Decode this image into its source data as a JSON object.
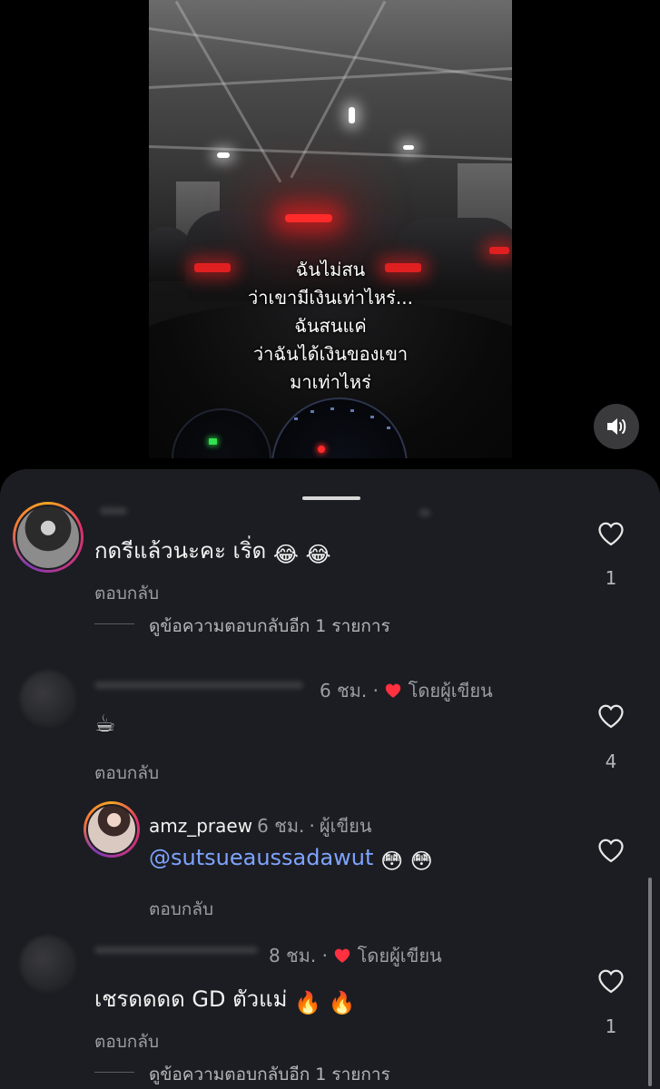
{
  "video": {
    "caption_lines": [
      "ฉันไม่สน",
      "ว่าเขามีเงินเท่าไหร่...",
      "ฉันสนแค่",
      "ว่าฉันได้เงินของเขา",
      "มาเท่าไหร่"
    ],
    "mute_icon": "speaker-icon"
  },
  "comments": {
    "c1": {
      "text": "กดรีแล้วนะคะ เริ่ด",
      "emojis": [
        "😂",
        "😂"
      ],
      "reply_label": "ตอบกลับ",
      "view_more": "ดูข้อความตอบกลับอีก 1 รายการ",
      "likes": "1"
    },
    "c2": {
      "time": "6 ชม.",
      "dot": "·",
      "liked_by_author": "โดยผู้เขียน",
      "text": "☕",
      "reply_label": "ตอบกลับ",
      "likes": "4"
    },
    "reply": {
      "username": "amz_praew",
      "time": "6 ชม.",
      "dot": "·",
      "author_badge": "ผู้เขียน",
      "mention": "@sutsueaussadawut",
      "emojis": [
        "😳",
        "😳"
      ],
      "reply_label": "ตอบกลับ"
    },
    "c3": {
      "time": "8 ชม.",
      "dot": "·",
      "liked_by_author": "โดยผู้เขียน",
      "text": "เชรดดดด GD ตัวแม่",
      "emojis": [
        "🔥",
        "🔥"
      ],
      "reply_label": "ตอบกลับ",
      "view_more": "ดูข้อความตอบกลับอีก 1 รายการ",
      "likes": "1"
    }
  },
  "colors": {
    "sheet_bg": "#1c1d22",
    "author_heart": "#ff3040",
    "mention": "#7ea3ff"
  }
}
